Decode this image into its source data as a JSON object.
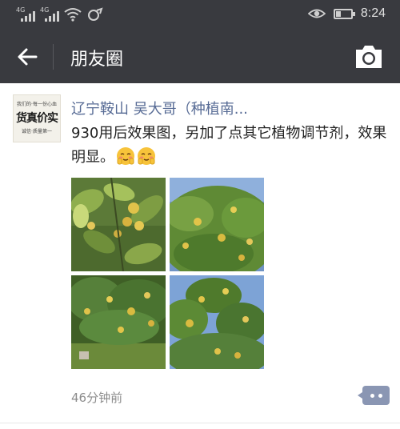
{
  "status_bar": {
    "signal1_label": "4G",
    "signal2_label": "4G",
    "time": "8:24",
    "battery_level": 0.3
  },
  "header": {
    "title": "朋友圈"
  },
  "post": {
    "avatar_text": {
      "top": "我们的·每一份心血",
      "main": "货真价实",
      "bottom": "诚信·质量第一"
    },
    "author": "辽宁鞍山  吴大哥（种植南...",
    "text": "930用后效果图，另加了点其它植物调节剂，效果明显。",
    "emoji_count": 2,
    "time": "46分钟前",
    "photos": [
      "persimmon-tree-photo-1",
      "persimmon-tree-photo-2",
      "persimmon-tree-photo-3",
      "persimmon-tree-photo-4"
    ]
  },
  "colors": {
    "header_bg": "#393a3f",
    "link": "#576b95",
    "comment_button": "#8a96b3"
  }
}
